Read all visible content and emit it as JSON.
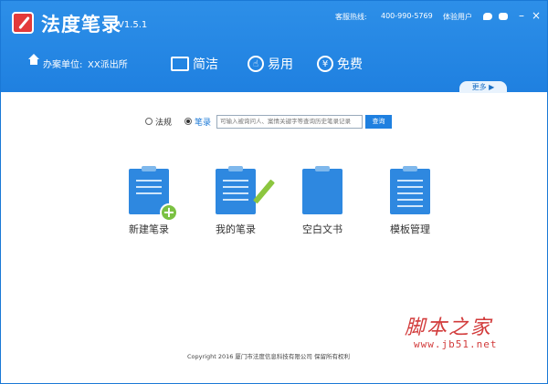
{
  "app": {
    "title": "法度笔录",
    "version": "V1.5.1"
  },
  "topbar": {
    "hotline_label": "客服热线:",
    "hotline_number": "400-990-5769",
    "trial_user": "体验用户",
    "minimize": "–",
    "close": "×"
  },
  "header": {
    "unit_label": "办案单位:",
    "unit_value": "XX派出所",
    "nav": [
      {
        "label": "简洁",
        "icon": "screen-icon"
      },
      {
        "label": "易用",
        "icon": "hand-icon"
      },
      {
        "label": "免费",
        "icon": "yen-icon"
      }
    ],
    "more_label": "更多 ▶"
  },
  "search": {
    "options": [
      {
        "label": "法规",
        "checked": false
      },
      {
        "label": "笔录",
        "checked": true
      }
    ],
    "placeholder": "可输入被询问人、案情关键字等查询历史笔录记录",
    "button": "查询"
  },
  "features": [
    {
      "label": "新建笔录",
      "icon": "new-record-icon"
    },
    {
      "label": "我的笔录",
      "icon": "my-records-icon"
    },
    {
      "label": "空白文书",
      "icon": "blank-document-icon"
    },
    {
      "label": "模板管理",
      "icon": "template-management-icon"
    }
  ],
  "footer": {
    "copyright": "Copyright  2016 厦门市法度信息科技有限公司  保留所有权利"
  },
  "watermark": {
    "cn": "脚本之家",
    "url": "www.jb51.net"
  },
  "colors": {
    "brand_blue": "#1f80e0",
    "accent_green": "#7bc142",
    "watermark_red": "#d23b3b"
  }
}
